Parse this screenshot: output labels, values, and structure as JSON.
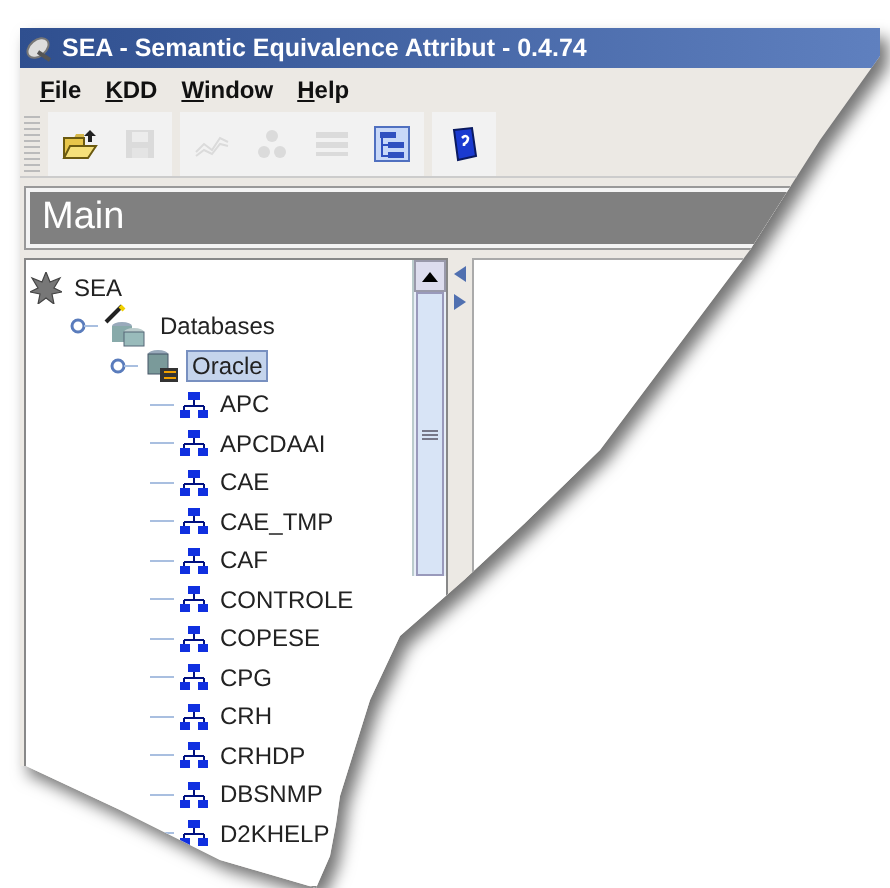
{
  "window": {
    "title": "SEA - Semantic Equivalence Attribut - 0.4.74"
  },
  "menu": [
    "File",
    "KDD",
    "Window",
    "Help"
  ],
  "toolbar": [
    [
      {
        "kind": "open",
        "disabled": false
      },
      {
        "kind": "save",
        "disabled": true
      }
    ],
    [
      {
        "kind": "chart",
        "disabled": true
      },
      {
        "kind": "cluster",
        "disabled": true
      },
      {
        "kind": "list",
        "disabled": true
      },
      {
        "kind": "tree",
        "disabled": false
      }
    ],
    [
      {
        "kind": "help",
        "disabled": false
      }
    ]
  ],
  "panel": {
    "title": "Main"
  },
  "tree": {
    "label": "SEA",
    "kind": "root",
    "selected": false,
    "children": [
      {
        "label": "Databases",
        "kind": "folder",
        "expanded": true,
        "selected": false,
        "children": [
          {
            "label": "Oracle",
            "kind": "database",
            "expanded": true,
            "selected": true,
            "children": [
              {
                "label": "APC",
                "kind": "schema",
                "selected": false
              },
              {
                "label": "APCDAAI",
                "kind": "schema",
                "selected": false
              },
              {
                "label": "CAE",
                "kind": "schema",
                "selected": false
              },
              {
                "label": "CAE_TMP",
                "kind": "schema",
                "selected": false
              },
              {
                "label": "CAF",
                "kind": "schema",
                "selected": false
              },
              {
                "label": "CONTROLE",
                "kind": "schema",
                "selected": false
              },
              {
                "label": "COPESE",
                "kind": "schema",
                "selected": false
              },
              {
                "label": "CPG",
                "kind": "schema",
                "selected": false
              },
              {
                "label": "CRH",
                "kind": "schema",
                "selected": false
              },
              {
                "label": "CRHDP",
                "kind": "schema",
                "selected": false
              },
              {
                "label": "DBSNMP",
                "kind": "schema",
                "selected": false
              },
              {
                "label": "D2KHELP",
                "kind": "schema",
                "selected": false
              }
            ]
          }
        ]
      }
    ]
  }
}
